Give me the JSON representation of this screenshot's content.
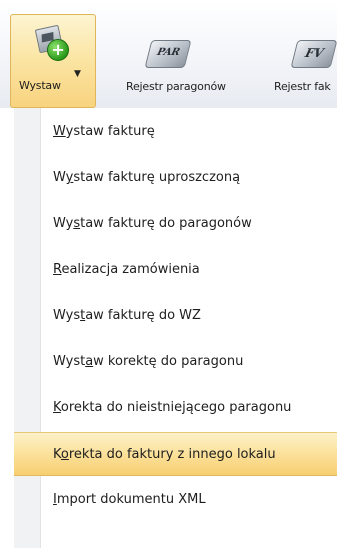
{
  "ribbon": {
    "wystaw": {
      "label": "Wystaw",
      "icon": "document-add-icon"
    },
    "rejestr_paragonow": {
      "label": "Rejestr paragonów",
      "icon_text": "PAR"
    },
    "rejestr_faktur": {
      "label": "Rejestr fak",
      "icon_text": "FV"
    }
  },
  "menu": {
    "items": [
      {
        "pre": "",
        "u": "W",
        "post": "ystaw fakturę"
      },
      {
        "pre": "W",
        "u": "y",
        "post": "staw fakturę uproszczoną"
      },
      {
        "pre": "Wy",
        "u": "s",
        "post": "taw fakturę do paragonów"
      },
      {
        "pre": "",
        "u": "R",
        "post": "ealizacja zamówienia"
      },
      {
        "pre": "Wys",
        "u": "t",
        "post": "aw fakturę do WZ"
      },
      {
        "pre": "Wyst",
        "u": "a",
        "post": "w korektę do paragonu"
      },
      {
        "pre": "",
        "u": "K",
        "post": "orekta do nieistniejącego paragonu"
      },
      {
        "pre": "K",
        "u": "o",
        "post": "rekta do faktury z innego lokalu"
      },
      {
        "pre": "",
        "u": "I",
        "post": "mport dokumentu XML"
      }
    ],
    "highlighted_index": 7,
    "highlight_color": "#fbe19a"
  }
}
